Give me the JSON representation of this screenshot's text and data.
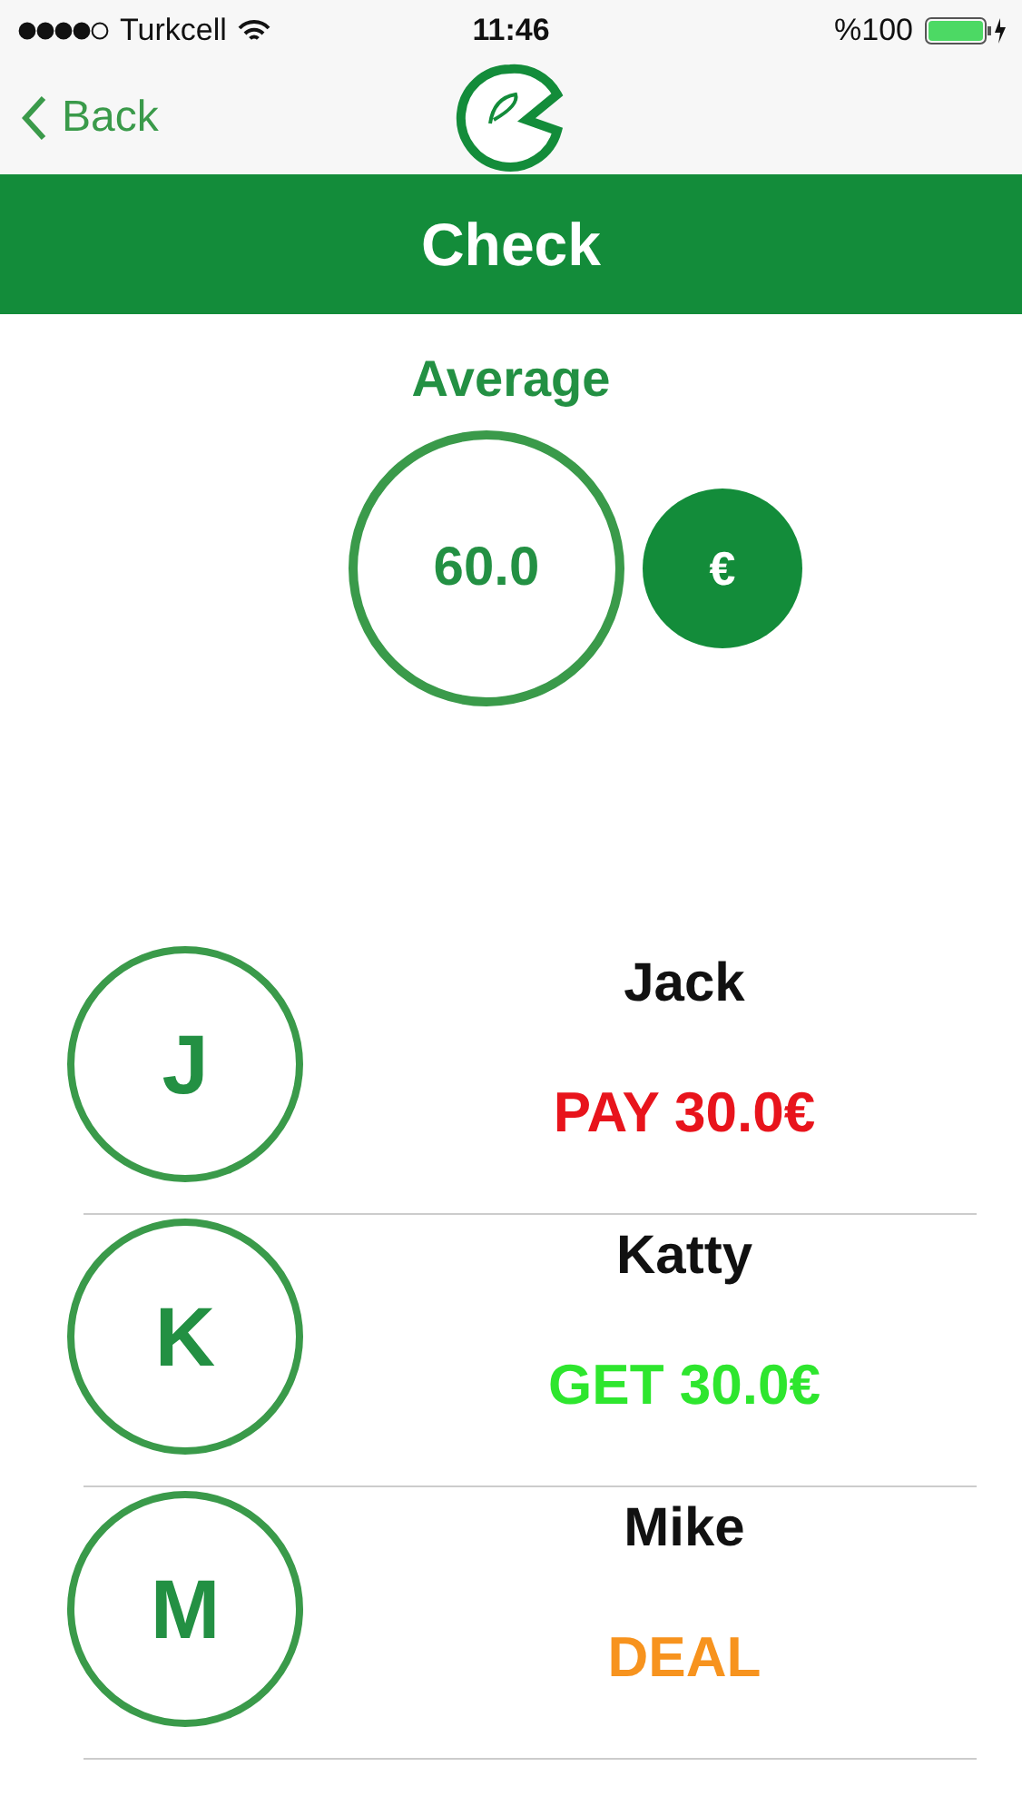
{
  "status_bar": {
    "carrier": "Turkcell",
    "time": "11:46",
    "battery": "%100"
  },
  "nav": {
    "back": "Back"
  },
  "header": {
    "title": "Check"
  },
  "average": {
    "label": "Average",
    "value": "60.0",
    "currency": "€"
  },
  "members": [
    {
      "initial": "J",
      "name": "Jack",
      "kind": "pay",
      "status": "PAY 30.0€"
    },
    {
      "initial": "K",
      "name": "Katty",
      "kind": "get",
      "status": "GET 30.0€"
    },
    {
      "initial": "M",
      "name": "Mike",
      "kind": "deal",
      "status": "DEAL"
    }
  ]
}
